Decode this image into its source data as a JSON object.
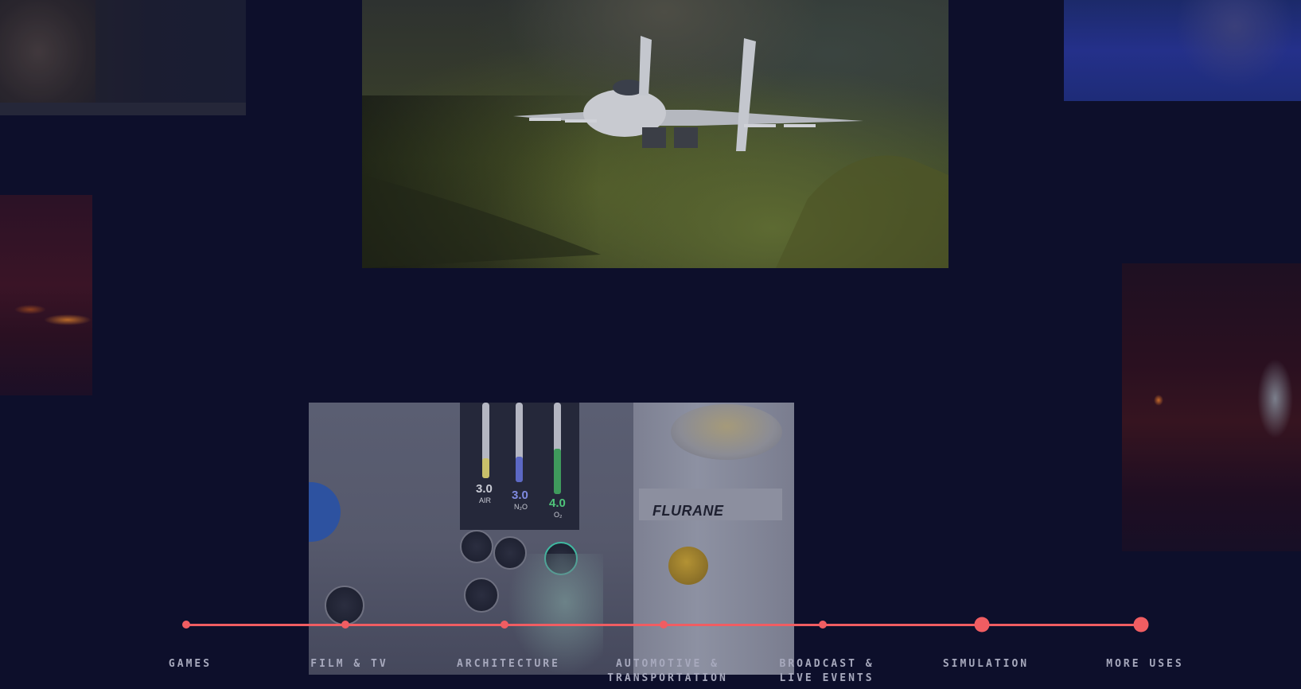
{
  "timeline": {
    "accent_color": "#f05d62",
    "items": [
      {
        "label": "GAMES",
        "active": false
      },
      {
        "label": "FILM & TV",
        "active": false
      },
      {
        "label": "ARCHITECTURE",
        "active": false
      },
      {
        "label": "AUTOMOTIVE &\nTRANSPORTATION",
        "active": false
      },
      {
        "label": "BROADCAST &\nLIVE EVENTS",
        "active": false
      },
      {
        "label": "SIMULATION",
        "active": true
      },
      {
        "label": "MORE USES",
        "active": true
      }
    ]
  },
  "images": {
    "jet": "fighter-jet-flying-over-valley",
    "simulation": "medical-anesthesia-machine-vr",
    "simulation_texts": {
      "air_value": "3.0",
      "air_label": "AIR",
      "n2o_value": "3.0",
      "n2o_label": "N₂O",
      "o2_value": "4.0",
      "o2_label": "O₂",
      "vaporizer_label": "FLURANE"
    }
  }
}
